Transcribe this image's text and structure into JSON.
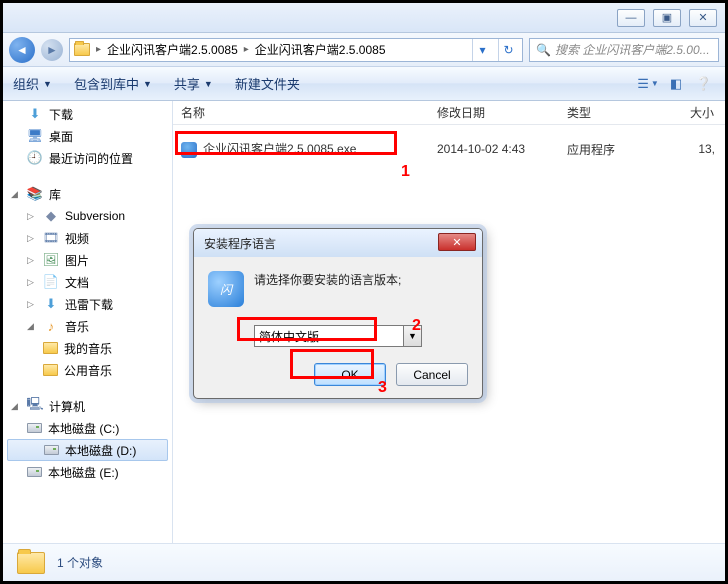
{
  "titlebar": {
    "min": "—",
    "max": "▣",
    "close": "✕"
  },
  "address": {
    "crumb1": "企业闪讯客户端2.5.0085",
    "crumb2": "企业闪讯客户端2.5.0085"
  },
  "search": {
    "placeholder": "搜索 企业闪讯客户端2.5.00..."
  },
  "toolbar": {
    "organize": "组织",
    "include": "包含到库中",
    "share": "共享",
    "newfolder": "新建文件夹"
  },
  "sidebar": {
    "downloads": "下载",
    "desktop": "桌面",
    "recent": "最近访问的位置",
    "library": "库",
    "subversion": "Subversion",
    "video": "视频",
    "pictures": "图片",
    "documents": "文档",
    "xunlei": "迅雷下载",
    "music": "音乐",
    "mymusic": "我的音乐",
    "publicmusic": "公用音乐",
    "computer": "计算机",
    "driveC": "本地磁盘 (C:)",
    "driveD": "本地磁盘 (D:)",
    "driveE": "本地磁盘 (E:)"
  },
  "columns": {
    "name": "名称",
    "date": "修改日期",
    "type": "类型",
    "size": "大小"
  },
  "file": {
    "name": "企业闪讯客户端2.5.0085.exe",
    "date": "2014-10-02 4:43",
    "type": "应用程序",
    "size": "13,"
  },
  "status": {
    "text": "1 个对象"
  },
  "dialog": {
    "title": "安装程序语言",
    "prompt": "请选择你要安装的语言版本;",
    "selected": "简体中文版",
    "ok": "OK",
    "cancel": "Cancel"
  },
  "annotations": {
    "a1": "1",
    "a2": "2",
    "a3": "3"
  }
}
